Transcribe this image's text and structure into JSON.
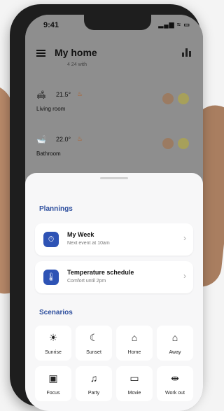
{
  "status_bar": {
    "time": "9:41",
    "icons": "▂▄▆ ≈ ▭"
  },
  "header": {
    "title": "My home",
    "subtitle": "4 24 with",
    "menu_icon": "menu-icon",
    "stats_icon": "bar-chart-icon"
  },
  "rooms": [
    {
      "icon": "sofa-icon",
      "glyph": "🛋",
      "temp": "21.5°",
      "name": "Living room"
    },
    {
      "icon": "bath-icon",
      "glyph": "🛁",
      "temp": "22.0°",
      "name": "Bathroom"
    }
  ],
  "plannings": {
    "title": "Plannings",
    "items": [
      {
        "icon": "clock-icon",
        "glyph": "⏱",
        "title": "My Week",
        "subtitle": "Next event at 10am"
      },
      {
        "icon": "thermometer-icon",
        "glyph": "🌡",
        "title": "Temperature schedule",
        "subtitle": "Comfort until 2pm"
      }
    ]
  },
  "scenarios": {
    "title": "Scenarios",
    "items": [
      {
        "icon": "sun-icon",
        "glyph": "☀",
        "label": "Sunrise"
      },
      {
        "icon": "moon-icon",
        "glyph": "☾",
        "label": "Sunset"
      },
      {
        "icon": "home-icon",
        "glyph": "⌂",
        "label": "Home"
      },
      {
        "icon": "away-icon",
        "glyph": "⌂",
        "label": "Away"
      },
      {
        "icon": "briefcase-icon",
        "glyph": "▣",
        "label": "Focus"
      },
      {
        "icon": "party-icon",
        "glyph": "♫",
        "label": "Party"
      },
      {
        "icon": "tv-icon",
        "glyph": "▭",
        "label": "Movie"
      },
      {
        "icon": "dumbbell-icon",
        "glyph": "⇹",
        "label": "Work out"
      }
    ]
  },
  "colors": {
    "accent": "#2e53b5",
    "section_title": "#2e4f9e"
  }
}
